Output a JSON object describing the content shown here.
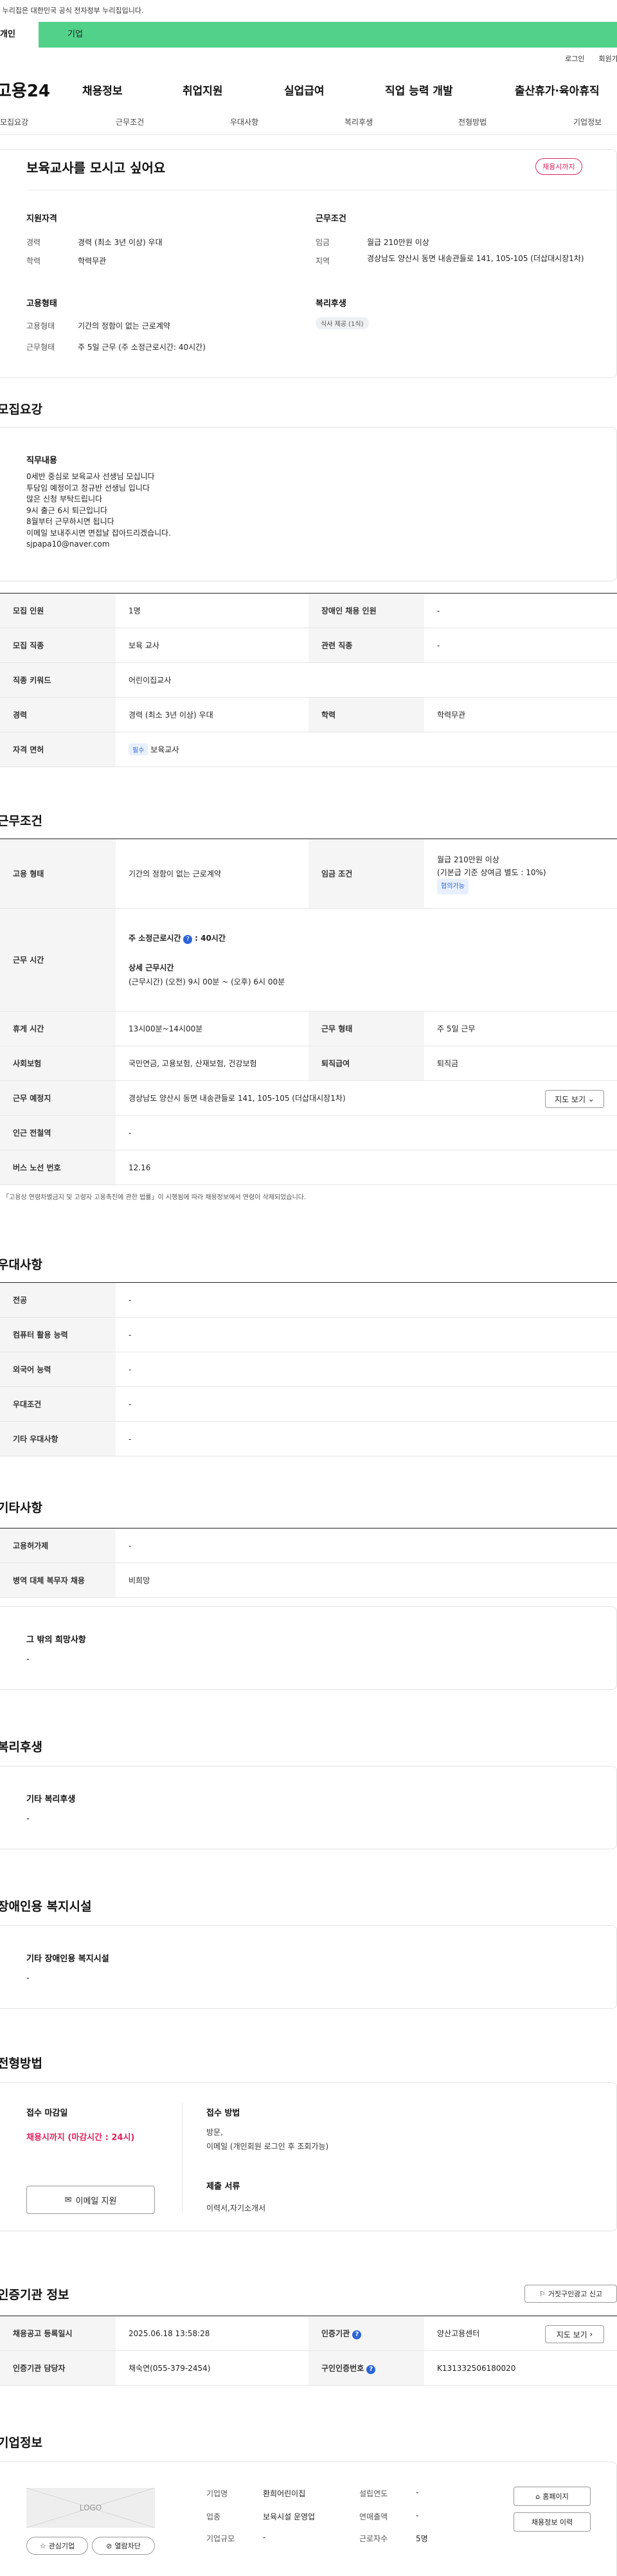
{
  "gov_banner": "이 누리집은 대한민국 공식 전자정부 누리집입니다.",
  "top_tabs": [
    "개인",
    "기업"
  ],
  "util_links": [
    "로그인",
    "회원가입"
  ],
  "logo": "고용24",
  "gnb": [
    "채용정보",
    "취업지원",
    "실업급여",
    "직업 능력 개발",
    "출산휴가·육아휴직"
  ],
  "jobnav": [
    "모집요강",
    "근무조건",
    "우대사항",
    "복리후생",
    "전형방법",
    "기업정보"
  ],
  "summary": {
    "title": "보육교사를 모시고 싶어요",
    "status_badge": "채용시까지",
    "qual_heading": "지원자격",
    "cond_heading": "근무조건",
    "career_label": "경력",
    "career_value": "경력 (최소 3년 이상) 우대",
    "edu_label": "학력",
    "edu_value": "학력무관",
    "wage_label": "임금",
    "wage_value": "월급 210만원 이상",
    "region_label": "지역",
    "region_value": "경상남도 양산시 동면 내송관들로 141, 105-105 (더삽대시장1차)",
    "emp_heading": "고용형태",
    "welfare_heading": "복리후생",
    "emptype_label": "고용형태",
    "emptype_value": "기간의 정함이 없는 근로계약",
    "worktype_label": "근무형태",
    "worktype_value": "주 5일 근무 (주 소정근로시간: 40시간)",
    "welfare_badge": "식사 제공 (1식)"
  },
  "recruit": {
    "title": "모집요강",
    "duty_heading": "직무내용",
    "duty_lines": [
      "0세반 중심로 보육교사 선생님 모십니다",
      "투담임 예정이고 정규반 선생님 입니다",
      "많은 신청 부탁드립니다",
      "9시 출근 6시 퇴근입니다",
      "8월부터 근무하시면 됩니다",
      "이메일 보내주시면 면접날 잡아드리겠습니다.",
      "sjpapa10@naver.com"
    ],
    "rows": [
      {
        "h1": "모집 인원",
        "v1": "1명",
        "h2": "장애인 채용 인원",
        "v2": "-"
      },
      {
        "h1": "모집 직종",
        "v1": "보육 교사",
        "h2": "관련 직종",
        "v2": "-"
      },
      {
        "h1": "직종 키워드",
        "v1": "어린이집교사"
      },
      {
        "h1": "경력",
        "v1": "경력 (최소 3년 이상) 우대",
        "h2": "학력",
        "v2": "학력무관"
      },
      {
        "h1": "자격 면허",
        "v1": "보육교사",
        "badge": "필수"
      }
    ]
  },
  "conditions": {
    "title": "근무조건",
    "emp_h": "고용 형태",
    "emp_v": "기간의 정함이 없는 근로계약",
    "wage_h": "임금 조건",
    "wage_v1": "월급 210만원 이상",
    "wage_v2": "(기본급 기준 상여금 별도 : 10%)",
    "wage_badge": "협의가능",
    "hours_h": "근무 시간",
    "hours_sub1": "주 소정근로시간",
    "hours_sub1_val": ": 40시간",
    "hours_sub2": "상세 근무시간",
    "hours_sub2_val": "(근무시간) (오전) 9시 00분 ~ (오후) 6시 00분",
    "rest_h": "휴게 시간",
    "rest_v": "13시00분~14시00분",
    "form_h": "근무 형태",
    "form_v": "주 5일 근무",
    "ins_h": "사회보험",
    "ins_v": "국민연금, 고용보험, 산재보험, 건강보험",
    "sev_h": "퇴직급여",
    "sev_v": "퇴직금",
    "place_h": "근무 예정지",
    "place_v": "경상남도 양산시 동면 내송관들로 141, 105-105 (더삽대시장1차)",
    "map_btn": "지도 보기",
    "subway_h": "인근 전철역",
    "subway_v": "-",
    "bus_h": "버스 노선 번호",
    "bus_v": "12.16",
    "note": "「고용상 연령차별금지 및 고령자 고용촉진에 관한 법률」이 시행됨에 따라 채용정보에서 연령이 삭제되었습니다."
  },
  "preference": {
    "title": "우대사항",
    "rows": [
      {
        "h": "전공",
        "v": "-"
      },
      {
        "h": "컴퓨터 활용 능력",
        "v": "-"
      },
      {
        "h": "외국어 능력",
        "v": "-"
      },
      {
        "h": "우대조건",
        "v": "-"
      },
      {
        "h": "기타 우대사항",
        "v": "-"
      }
    ]
  },
  "etc": {
    "title": "기타사항",
    "rows": [
      {
        "h": "고용허가제",
        "v": "-"
      },
      {
        "h": "병역 대체 복무자 채용",
        "v": "비희망"
      }
    ],
    "hope_heading": "그 밖의 희망사항",
    "hope_value": "-"
  },
  "welfare": {
    "title": "복리후생",
    "heading": "기타 복리후생",
    "value": "-"
  },
  "disabled": {
    "title": "장애인용 복지시설",
    "heading": "기타 장애인용 복지시설",
    "value": "-"
  },
  "selection": {
    "title": "전형방법",
    "deadline_h": "접수 마감일",
    "deadline_v": "채용시까지 (마감시간 : 24시)",
    "email_btn": "이메일 지원",
    "method_h": "접수 방법",
    "method_v1": "방문,",
    "method_v2": "이메일 (개인회원 로그인 후 조회가능)",
    "docs_h": "제출 서류",
    "docs_v": "이력서,자기소개서"
  },
  "agency": {
    "title": "인증기관 정보",
    "report_btn": "거짓구인광고 신고",
    "reg_h": "채용공고 등록일시",
    "reg_v": "2025.06.18 13:58:28",
    "org_h": "인증기관",
    "org_v": "양산고용센터",
    "map_btn": "지도 보기",
    "staff_h": "인증기관 담당자",
    "staff_v": "채숙연(055-379-2454)",
    "num_h": "구인인증번호",
    "num_v": "K131332506180020"
  },
  "company": {
    "title": "기업정보",
    "logo_text": "LOGO",
    "fav_btn": "관심기업",
    "block_btn": "열람차단",
    "name_h": "기업명",
    "name_v": "환희어린이집",
    "year_h": "설립연도",
    "year_v": "-",
    "industry_h": "업종",
    "industry_v": "보육시설 운영업",
    "sales_h": "연매출액",
    "sales_v": "-",
    "size_h": "기업규모",
    "size_v": "-",
    "staff_h": "근로자수",
    "staff_v": "5명",
    "home_btn": "홈페이지",
    "jobs_btn": "채용정보 이력"
  },
  "colors": {
    "accent_green": "#52d18a",
    "status_pink": "#e0245e",
    "info_blue": "#2c64d8"
  }
}
